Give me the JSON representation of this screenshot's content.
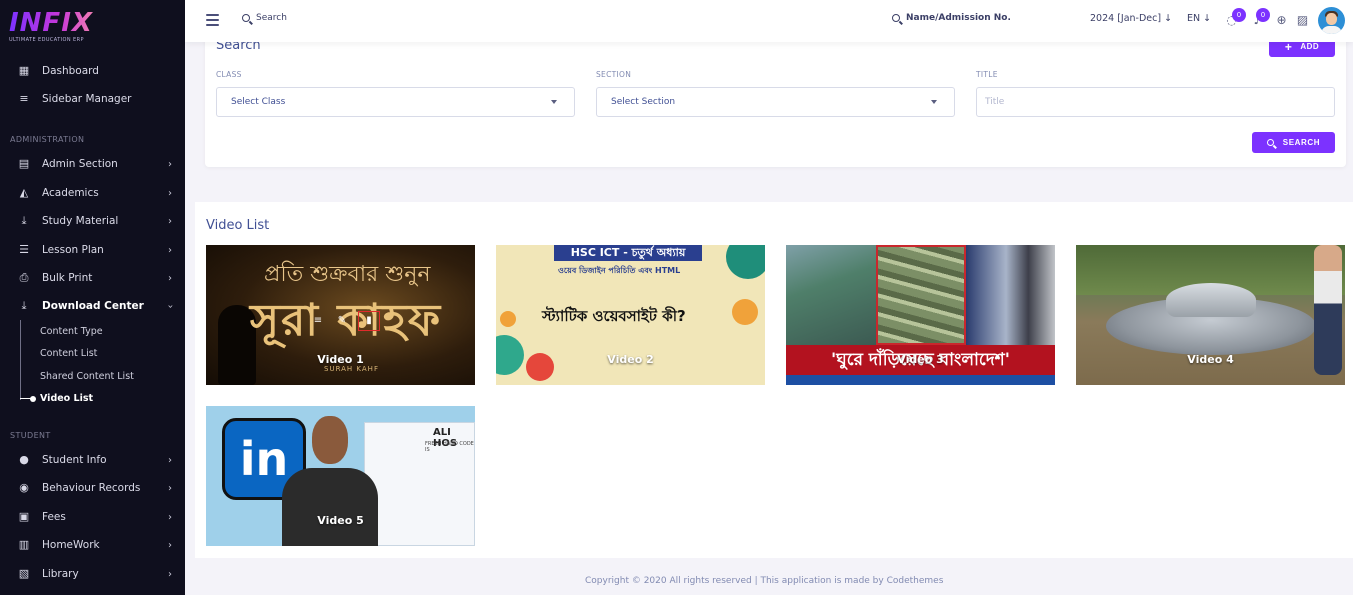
{
  "brand": {
    "name": "INFIX",
    "tagline": "ULTIMATE EDUCATION ERP"
  },
  "sidebar": {
    "top_items": [
      {
        "label": "Dashboard",
        "icon": "grid-icon"
      },
      {
        "label": "Sidebar Manager",
        "icon": "bars-icon"
      }
    ],
    "section_admin": "ADMINISTRATION",
    "admin_items": [
      {
        "label": "Admin Section",
        "icon": "id-card-icon"
      },
      {
        "label": "Academics",
        "icon": "graduation-cap-icon"
      },
      {
        "label": "Study Material",
        "icon": "download-icon"
      },
      {
        "label": "Lesson Plan",
        "icon": "list-icon"
      },
      {
        "label": "Bulk Print",
        "icon": "printer-icon"
      },
      {
        "label": "Download Center",
        "icon": "download-icon"
      }
    ],
    "download_sub": [
      "Content Type",
      "Content List",
      "Shared Content List",
      "Video List"
    ],
    "section_student": "STUDENT",
    "student_items": [
      {
        "label": "Student Info",
        "icon": "user-icon"
      },
      {
        "label": "Behaviour Records",
        "icon": "users-icon"
      },
      {
        "label": "Fees",
        "icon": "money-icon"
      },
      {
        "label": "HomeWork",
        "icon": "book-icon"
      },
      {
        "label": "Library",
        "icon": "library-icon"
      }
    ]
  },
  "topbar": {
    "search_label": "Search",
    "admission_search": "Name/Admission No.",
    "session": "2024 [Jan-Dec]",
    "language": "EN",
    "messages_count": "0",
    "notifications_count": "0"
  },
  "search_panel": {
    "title": "Search",
    "add_label": "ADD",
    "class_label": "CLASS",
    "class_value": "Select Class",
    "section_label": "SECTION",
    "section_value": "Select Section",
    "title_label": "TITLE",
    "title_placeholder": "Title",
    "search_button": "SEARCH"
  },
  "video_list": {
    "title": "Video List",
    "videos": [
      {
        "label": "Video 1",
        "art_text_1": "প্রতি শুক্রবার শুনুন",
        "art_text_2": "সূরা কাহফ",
        "art_text_3": "SURAH KAHF"
      },
      {
        "label": "Video 2",
        "art_text_1": "HSC ICT - চতুর্থ অধ্যায়",
        "art_text_2": "ওয়েব ডিজাইন পরিচিতি এবং HTML",
        "art_text_3": "স্ট্যাটিক ওয়েবসাইট কী?"
      },
      {
        "label": "Video 3",
        "art_text_1": "'ঘুরে দাঁড়িয়েছে বাংলাদেশ'"
      },
      {
        "label": "Video 4"
      },
      {
        "label": "Video 5",
        "art_text_1": "in",
        "art_text_2": "ALI HOS",
        "art_text_3": "FRESH HAND CODE IS"
      }
    ]
  },
  "footer": "Copyright © 2020 All rights reserved | This application is made by Codethemes",
  "colors": {
    "accent": "#7c32ff",
    "sidebar_bg": "#0f0f1e",
    "text": "#415094"
  }
}
